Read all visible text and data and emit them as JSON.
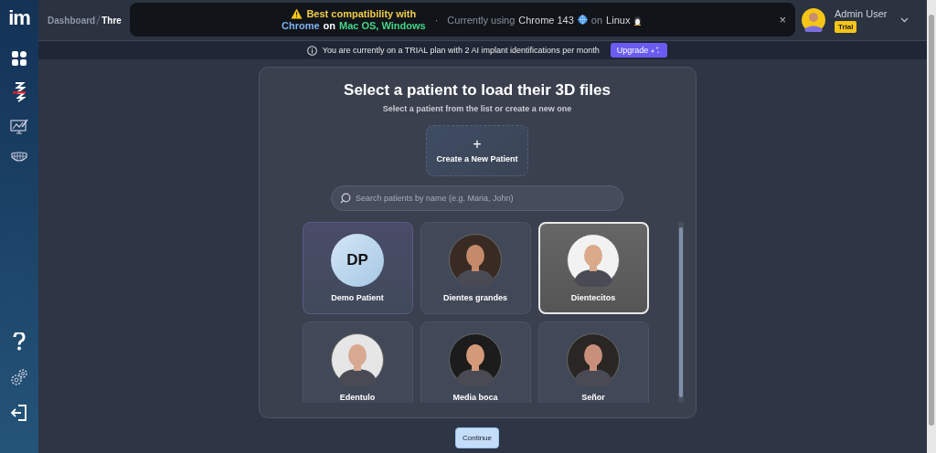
{
  "sidebar": {
    "logo": "im"
  },
  "breadcrumb": [
    "Dashboard",
    "Thre"
  ],
  "banner": {
    "title": "Best compatibility with",
    "browser": "Chrome",
    "on_word": "on",
    "platforms": "Mac OS, Windows",
    "separator": "·",
    "current_prefix": "Currently using",
    "current_browser": "Chrome 143",
    "current_on": "on",
    "current_os": "Linux",
    "close": "×"
  },
  "user": {
    "name": "Admin User",
    "badge": "Trial"
  },
  "trial_notice": {
    "text": "You are currently on a TRIAL plan with 2 AI implant identifications per month",
    "button": "Upgrade"
  },
  "modal": {
    "title": "Select a patient to load their 3D files",
    "subtitle": "Select a patient from the list or create a new one",
    "create_icon": "+",
    "create_label": "Create a New Patient",
    "search": {
      "placeholder": "Search patients by name (e.g. Maria, John)"
    },
    "patients": [
      {
        "name": "Demo Patient",
        "kind": "initials",
        "initials": "DP",
        "selected": false
      },
      {
        "name": "Dientes grandes",
        "selected": false
      },
      {
        "name": "Dientecitos",
        "selected": true
      },
      {
        "name": "Edentulo",
        "selected": false
      },
      {
        "name": "Media boca",
        "selected": false
      },
      {
        "name": "Señor",
        "selected": false
      }
    ]
  },
  "continue_button": "Continue"
}
